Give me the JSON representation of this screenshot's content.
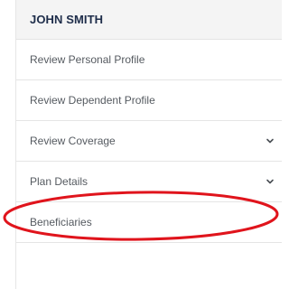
{
  "sidebar": {
    "user_name": "JOHN SMITH",
    "items": [
      {
        "label": "Review Personal Profile",
        "has_chevron": false
      },
      {
        "label": "Review Dependent Profile",
        "has_chevron": false
      },
      {
        "label": "Review Coverage",
        "has_chevron": true
      },
      {
        "label": "Plan Details",
        "has_chevron": true,
        "highlighted": true
      },
      {
        "label": "Beneficiaries",
        "has_chevron": false
      }
    ]
  },
  "colors": {
    "header_bg": "#f4f4f4",
    "name_text": "#1e2d4a",
    "item_text": "#555a60",
    "divider": "#e5e5e5",
    "highlight_ring": "#e0141c"
  },
  "icons": {
    "chevron": "chevron-down-icon"
  }
}
